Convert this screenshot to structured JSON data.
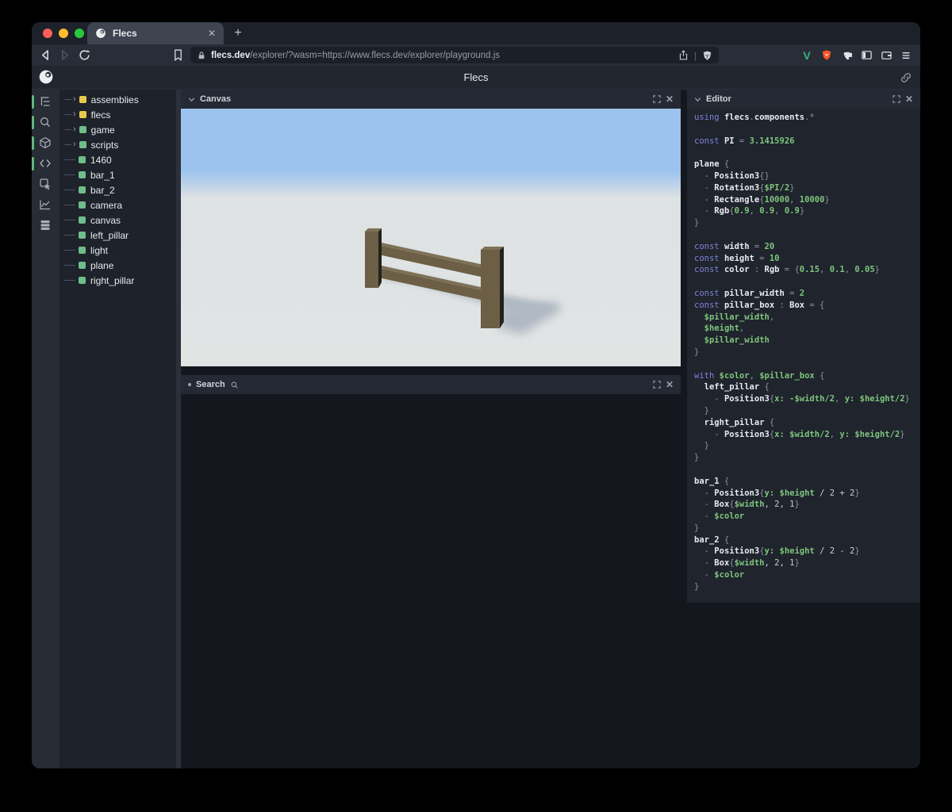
{
  "browser": {
    "tab_title": "Flecs",
    "new_tab_label": "+",
    "url_domain": "flecs.dev",
    "url_path": "/explorer/?wasm=https://www.flecs.dev/explorer/playground.js",
    "extension_letter": "V"
  },
  "header": {
    "title": "Flecs"
  },
  "sidebar": {
    "icons": [
      {
        "name": "hierarchy",
        "active": true
      },
      {
        "name": "search",
        "active": true
      },
      {
        "name": "cube",
        "active": true
      },
      {
        "name": "code",
        "active": true
      },
      {
        "name": "inspect",
        "active": false
      },
      {
        "name": "stats",
        "active": false
      },
      {
        "name": "tables",
        "active": false
      }
    ],
    "active_indicator_color": "#5fb87a"
  },
  "tree": {
    "yellow": "#e8c94f",
    "green": "#6fbd8a",
    "items": [
      {
        "label": "assemblies",
        "color": "yellow",
        "expandable": true
      },
      {
        "label": "flecs",
        "color": "yellow",
        "expandable": true
      },
      {
        "label": "game",
        "color": "green",
        "expandable": true
      },
      {
        "label": "scripts",
        "color": "green",
        "expandable": true
      },
      {
        "label": "1460",
        "color": "green",
        "expandable": false
      },
      {
        "label": "bar_1",
        "color": "green",
        "expandable": false
      },
      {
        "label": "bar_2",
        "color": "green",
        "expandable": false
      },
      {
        "label": "camera",
        "color": "green",
        "expandable": false
      },
      {
        "label": "canvas",
        "color": "green",
        "expandable": false
      },
      {
        "label": "left_pillar",
        "color": "green",
        "expandable": false
      },
      {
        "label": "light",
        "color": "green",
        "expandable": false
      },
      {
        "label": "plane",
        "color": "green",
        "expandable": false
      },
      {
        "label": "right_pillar",
        "color": "green",
        "expandable": false
      }
    ]
  },
  "panels": {
    "canvas": {
      "title": "Canvas"
    },
    "search": {
      "title": "Search"
    },
    "editor": {
      "title": "Editor"
    }
  },
  "scene": {
    "sky": "#9cc3ee",
    "horizon": "#dde2e3",
    "ground": "#e2e4e4",
    "fence_front": "#6c5f45",
    "fence_top": "#7d7157",
    "fence_side": "#23221c",
    "shadow": "#8796a8"
  },
  "syntax": {
    "kw": "#7e83da",
    "id": "#e8ebf0",
    "pun": "#8b92a0",
    "num": "#7fc57d",
    "var": "#7fc57d",
    "pln": "#c9ced8"
  },
  "code": {
    "lines": [
      [
        [
          "kw",
          "using"
        ],
        [
          "pln",
          " "
        ],
        [
          "id",
          "flecs"
        ],
        [
          "pun",
          "."
        ],
        [
          "id",
          "components"
        ],
        [
          "pun",
          ".*"
        ]
      ],
      [],
      [
        [
          "kw",
          "const"
        ],
        [
          "pln",
          " "
        ],
        [
          "id",
          "PI"
        ],
        [
          "pun",
          " = "
        ],
        [
          "num",
          "3.1415926"
        ]
      ],
      [],
      [
        [
          "id",
          "plane"
        ],
        [
          "pun",
          " {"
        ]
      ],
      [
        [
          "pun",
          "  - "
        ],
        [
          "id",
          "Position3"
        ],
        [
          "pun",
          "{}"
        ]
      ],
      [
        [
          "pun",
          "  - "
        ],
        [
          "id",
          "Rotation3"
        ],
        [
          "pun",
          "{"
        ],
        [
          "var",
          "$PI/2"
        ],
        [
          "pun",
          "}"
        ]
      ],
      [
        [
          "pun",
          "  - "
        ],
        [
          "id",
          "Rectangle"
        ],
        [
          "pun",
          "{"
        ],
        [
          "num",
          "10000"
        ],
        [
          "pun",
          ", "
        ],
        [
          "num",
          "10000"
        ],
        [
          "pun",
          "}"
        ]
      ],
      [
        [
          "pun",
          "  - "
        ],
        [
          "id",
          "Rgb"
        ],
        [
          "pun",
          "{"
        ],
        [
          "num",
          "0.9"
        ],
        [
          "pun",
          ", "
        ],
        [
          "num",
          "0.9"
        ],
        [
          "pun",
          ", "
        ],
        [
          "num",
          "0.9"
        ],
        [
          "pun",
          "}"
        ]
      ],
      [
        [
          "pun",
          "}"
        ]
      ],
      [],
      [
        [
          "kw",
          "const"
        ],
        [
          "pln",
          " "
        ],
        [
          "id",
          "width"
        ],
        [
          "pun",
          " = "
        ],
        [
          "num",
          "20"
        ]
      ],
      [
        [
          "kw",
          "const"
        ],
        [
          "pln",
          " "
        ],
        [
          "id",
          "height"
        ],
        [
          "pun",
          " = "
        ],
        [
          "num",
          "10"
        ]
      ],
      [
        [
          "kw",
          "const"
        ],
        [
          "pln",
          " "
        ],
        [
          "id",
          "color"
        ],
        [
          "pun",
          " : "
        ],
        [
          "id",
          "Rgb"
        ],
        [
          "pun",
          " = {"
        ],
        [
          "num",
          "0.15"
        ],
        [
          "pun",
          ", "
        ],
        [
          "num",
          "0.1"
        ],
        [
          "pun",
          ", "
        ],
        [
          "num",
          "0.05"
        ],
        [
          "pun",
          "}"
        ]
      ],
      [],
      [
        [
          "kw",
          "const"
        ],
        [
          "pln",
          " "
        ],
        [
          "id",
          "pillar_width"
        ],
        [
          "pun",
          " = "
        ],
        [
          "num",
          "2"
        ]
      ],
      [
        [
          "kw",
          "const"
        ],
        [
          "pln",
          " "
        ],
        [
          "id",
          "pillar_box"
        ],
        [
          "pun",
          " : "
        ],
        [
          "id",
          "Box"
        ],
        [
          "pun",
          " = {"
        ]
      ],
      [
        [
          "pun",
          "  "
        ],
        [
          "var",
          "$pillar_width"
        ],
        [
          "pun",
          ","
        ]
      ],
      [
        [
          "pun",
          "  "
        ],
        [
          "var",
          "$height"
        ],
        [
          "pun",
          ","
        ]
      ],
      [
        [
          "pun",
          "  "
        ],
        [
          "var",
          "$pillar_width"
        ]
      ],
      [
        [
          "pun",
          "}"
        ]
      ],
      [],
      [
        [
          "kw",
          "with"
        ],
        [
          "pln",
          " "
        ],
        [
          "var",
          "$color"
        ],
        [
          "pun",
          ", "
        ],
        [
          "var",
          "$pillar_box"
        ],
        [
          "pun",
          " {"
        ]
      ],
      [
        [
          "pun",
          "  "
        ],
        [
          "id",
          "left_pillar"
        ],
        [
          "pun",
          " {"
        ]
      ],
      [
        [
          "pun",
          "    - "
        ],
        [
          "id",
          "Position3"
        ],
        [
          "pun",
          "{"
        ],
        [
          "var",
          "x: -$width/2"
        ],
        [
          "pun",
          ", "
        ],
        [
          "var",
          "y: $height/2"
        ],
        [
          "pun",
          "}"
        ]
      ],
      [
        [
          "pun",
          "  }"
        ]
      ],
      [
        [
          "pun",
          "  "
        ],
        [
          "id",
          "right_pillar"
        ],
        [
          "pun",
          " {"
        ]
      ],
      [
        [
          "pun",
          "    - "
        ],
        [
          "id",
          "Position3"
        ],
        [
          "pun",
          "{"
        ],
        [
          "var",
          "x: $width/2"
        ],
        [
          "pun",
          ", "
        ],
        [
          "var",
          "y: $height/2"
        ],
        [
          "pun",
          "}"
        ]
      ],
      [
        [
          "pun",
          "  }"
        ]
      ],
      [
        [
          "pun",
          "}"
        ]
      ],
      [],
      [
        [
          "id",
          "bar_1"
        ],
        [
          "pun",
          " {"
        ]
      ],
      [
        [
          "pun",
          "  - "
        ],
        [
          "id",
          "Position3"
        ],
        [
          "pun",
          "{"
        ],
        [
          "var",
          "y: $height"
        ],
        [
          "pln",
          " / 2 + 2"
        ],
        [
          "pun",
          "}"
        ]
      ],
      [
        [
          "pun",
          "  - "
        ],
        [
          "id",
          "Box"
        ],
        [
          "pun",
          "{"
        ],
        [
          "var",
          "$width"
        ],
        [
          "pln",
          ", 2, 1"
        ],
        [
          "pun",
          "}"
        ]
      ],
      [
        [
          "pun",
          "  - "
        ],
        [
          "var",
          "$color"
        ]
      ],
      [
        [
          "pun",
          "}"
        ]
      ],
      [
        [
          "id",
          "bar_2"
        ],
        [
          "pun",
          " {"
        ]
      ],
      [
        [
          "pun",
          "  - "
        ],
        [
          "id",
          "Position3"
        ],
        [
          "pun",
          "{"
        ],
        [
          "var",
          "y: $height"
        ],
        [
          "pln",
          " / 2 - 2"
        ],
        [
          "pun",
          "}"
        ]
      ],
      [
        [
          "pun",
          "  - "
        ],
        [
          "id",
          "Box"
        ],
        [
          "pun",
          "{"
        ],
        [
          "var",
          "$width"
        ],
        [
          "pln",
          ", 2, 1"
        ],
        [
          "pun",
          "}"
        ]
      ],
      [
        [
          "pun",
          "  - "
        ],
        [
          "var",
          "$color"
        ]
      ],
      [
        [
          "pun",
          "}"
        ]
      ]
    ]
  }
}
